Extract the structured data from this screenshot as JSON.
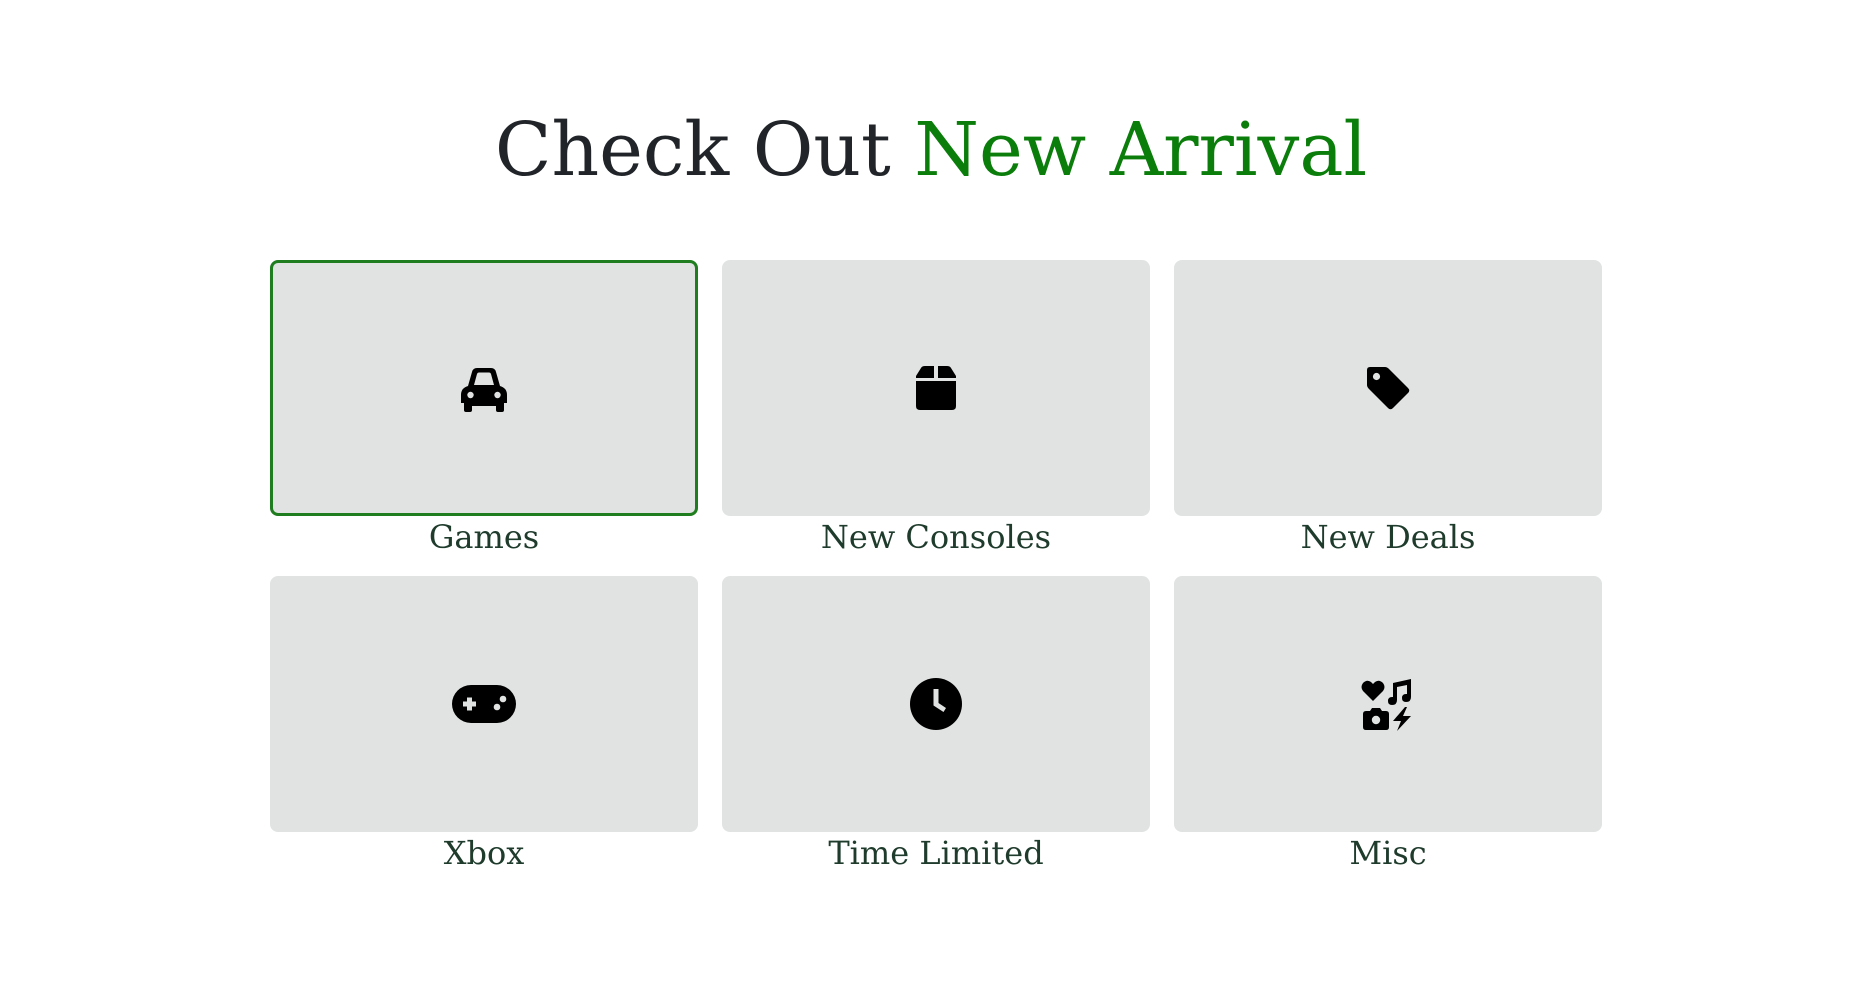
{
  "header": {
    "title_prefix": "Check Out ",
    "title_accent": "New Arrival"
  },
  "accent_color": "#0a7d0a",
  "categories": [
    {
      "label": "Games",
      "icon": "car-icon",
      "selected": true
    },
    {
      "label": "New Consoles",
      "icon": "box-icon",
      "selected": false
    },
    {
      "label": "New Deals",
      "icon": "tag-icon",
      "selected": false
    },
    {
      "label": "Xbox",
      "icon": "gamepad-icon",
      "selected": false
    },
    {
      "label": "Time Limited",
      "icon": "clock-icon",
      "selected": false
    },
    {
      "label": "Misc",
      "icon": "icons-icon",
      "selected": false
    }
  ]
}
